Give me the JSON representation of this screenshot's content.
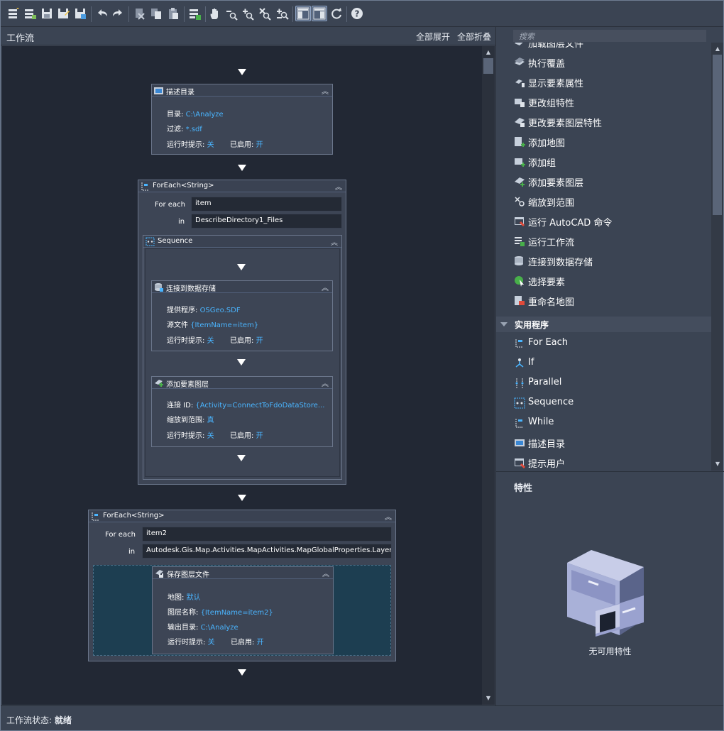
{
  "toolbar": {
    "items": [
      "new-workflow-icon",
      "new-workflow-from-icon",
      "save-icon",
      "save-as-icon",
      "save-image-icon",
      "undo-icon",
      "redo-icon",
      "cut-icon",
      "copy-icon",
      "paste-icon",
      "run-workflow-icon",
      "pan-icon",
      "zoom-out-icon",
      "zoom-in-icon",
      "zoom-extents-icon",
      "zoom-add-icon",
      "layout-left-icon",
      "layout-right-icon",
      "refresh-icon",
      "help-icon"
    ]
  },
  "left_panel": {
    "title": "工作流",
    "expand_all": "全部展开",
    "collapse_all": "全部折叠"
  },
  "workflow": {
    "describe_dir": {
      "title": "描述目录",
      "dir_label": "目录:",
      "dir_value": "C:\\Analyze",
      "filter_label": "过滤:",
      "filter_value": "*.sdf",
      "prompt_label": "运行时提示:",
      "prompt_value": "关",
      "enabled_label": "已启用:",
      "enabled_value": "开"
    },
    "foreach1": {
      "title": "ForEach<String>",
      "for_each_label": "For each",
      "for_each_value": "item",
      "in_label": "in",
      "in_value": "DescribeDirectory1_Files"
    },
    "sequence": {
      "title": "Sequence"
    },
    "connect": {
      "title": "连接到数据存储",
      "provider_label": "提供程序:",
      "provider_value": "OSGeo.SDF",
      "source_label": "源文件",
      "source_value": "{ItemName=item}",
      "prompt_label": "运行时提示:",
      "prompt_value": "关",
      "enabled_label": "已启用:",
      "enabled_value": "开"
    },
    "addlayer": {
      "title": "添加要素图层",
      "conn_label": "连接 ID:",
      "conn_value": "{Activity=ConnectToFdoDataStore...",
      "zoom_label": "缩放到范围:",
      "zoom_value": "真",
      "prompt_label": "运行时提示:",
      "prompt_value": "关",
      "enabled_label": "已启用:",
      "enabled_value": "开"
    },
    "foreach2": {
      "title": "ForEach<String>",
      "for_each_label": "For each",
      "for_each_value": "item2",
      "in_label": "in",
      "in_value": "Autodesk.Gis.Map.Activities.MapActivities.MapGlobalProperties.Layers"
    },
    "savelayer": {
      "title": "保存图层文件",
      "map_label": "地图:",
      "map_value": "默认",
      "layer_label": "图层名称:",
      "layer_value": "{ItemName=item2}",
      "out_label": "输出目录:",
      "out_value": "C:\\Analyze",
      "prompt_label": "运行时提示:",
      "prompt_value": "关",
      "enabled_label": "已启用:",
      "enabled_value": "开"
    }
  },
  "right_panel": {
    "search_placeholder": "搜索",
    "partial_item": "加载图层文件",
    "items": [
      {
        "label": "执行覆盖",
        "icon": "overlay-icon"
      },
      {
        "label": "显示要素属性",
        "icon": "feature-attributes-icon"
      },
      {
        "label": "更改组特性",
        "icon": "group-properties-icon"
      },
      {
        "label": "更改要素图层特性",
        "icon": "layer-properties-icon"
      },
      {
        "label": "添加地图",
        "icon": "add-map-icon"
      },
      {
        "label": "添加组",
        "icon": "add-group-icon"
      },
      {
        "label": "添加要素图层",
        "icon": "add-layer-icon"
      },
      {
        "label": "缩放到范围",
        "icon": "zoom-extents-icon"
      },
      {
        "label": "运行 AutoCAD 命令",
        "icon": "autocad-command-icon"
      },
      {
        "label": "运行工作流",
        "icon": "run-workflow-icon"
      },
      {
        "label": "连接到数据存储",
        "icon": "datastore-icon"
      },
      {
        "label": "选择要素",
        "icon": "select-features-icon"
      },
      {
        "label": "重命名地图",
        "icon": "rename-map-icon"
      }
    ],
    "category": "实用程序",
    "util_items": [
      {
        "label": "For Each",
        "icon": "foreach-icon"
      },
      {
        "label": "If",
        "icon": "if-icon"
      },
      {
        "label": "Parallel",
        "icon": "parallel-icon"
      },
      {
        "label": "Sequence",
        "icon": "sequence-icon"
      },
      {
        "label": "While",
        "icon": "while-icon"
      },
      {
        "label": "描述目录",
        "icon": "describe-directory-icon"
      },
      {
        "label": "提示用户",
        "icon": "prompt-user-icon"
      }
    ],
    "properties_title": "特性",
    "no_properties": "无可用特性"
  },
  "status": {
    "label": "工作流状态:",
    "value": "就绪"
  }
}
